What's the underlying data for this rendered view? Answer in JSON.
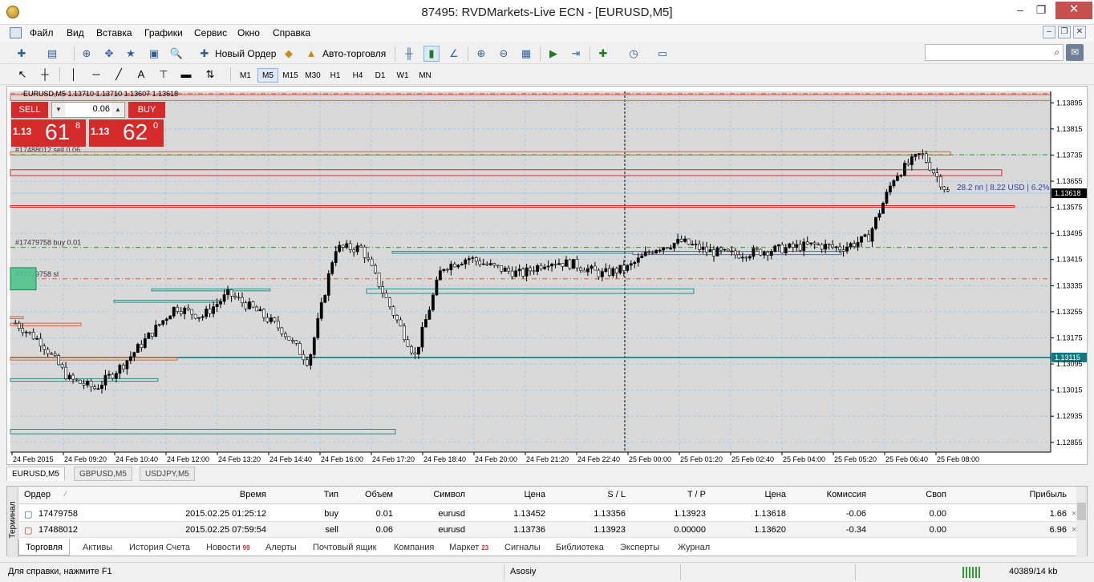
{
  "window": {
    "title": "87495: RVDMarkets-Live ECN - [EURUSD,M5]",
    "minimize": "–",
    "restore": "❐",
    "close": "✕"
  },
  "menu": [
    "Файл",
    "Вид",
    "Вставка",
    "Графики",
    "Сервис",
    "Окно",
    "Справка"
  ],
  "toolbar": {
    "new_order": "Новый Ордер",
    "auto_trading": "Авто-торговля"
  },
  "timeframes": [
    "M1",
    "M5",
    "M15",
    "M30",
    "H1",
    "H4",
    "D1",
    "W1",
    "MN"
  ],
  "active_timeframe": "M5",
  "chart": {
    "ohlc_line": "EURUSD,M5  1.13710 1.13710 1.13607 1.13618",
    "sell_label": "SELL",
    "buy_label": "BUY",
    "lot": "0.06",
    "sell_big": "1.13",
    "sell_pips": "61",
    "sell_frac": "8",
    "buy_big": "1.13",
    "buy_pips": "62",
    "buy_frac": "0",
    "order_labels": [
      "#17488012 sell 0.06",
      "#17479758 buy 0.01",
      "#17479758 sl"
    ],
    "pnl_label": "28.2 пп | 8.22 USD | 6.2%",
    "current_price": "1.13618",
    "line_price": "1.13115",
    "price_ticks": [
      "1.13895",
      "1.13815",
      "1.13735",
      "1.13655",
      "1.13575",
      "1.13495",
      "1.13415",
      "1.13335",
      "1.13255",
      "1.13175",
      "1.13095",
      "1.13015",
      "1.12935",
      "1.12855"
    ],
    "time_ticks": [
      "24 Feb 2015",
      "24 Feb 09:20",
      "24 Feb 10:40",
      "24 Feb 12:00",
      "24 Feb 13:20",
      "24 Feb 14:40",
      "24 Feb 16:00",
      "24 Feb 17:20",
      "24 Feb 18:40",
      "24 Feb 20:00",
      "24 Feb 21:20",
      "24 Feb 22:40",
      "25 Feb 00:00",
      "25 Feb 01:20",
      "25 Feb 02:40",
      "25 Feb 04:00",
      "25 Feb 05:20",
      "25 Feb 06:40",
      "25 Feb 08:00"
    ]
  },
  "chart_data": {
    "type": "candlestick",
    "symbol": "EURUSD",
    "timeframe": "M5",
    "ylim": [
      1.12825,
      1.1393
    ],
    "grid": true,
    "close_trend": [
      1.1322,
      1.1316,
      1.1305,
      1.1302,
      1.1309,
      1.1318,
      1.1327,
      1.1324,
      1.1331,
      1.1326,
      1.132,
      1.131,
      1.1345,
      1.1345,
      1.1328,
      1.1312,
      1.1339,
      1.1342,
      1.1339,
      1.1337,
      1.1341,
      1.134,
      1.1337,
      1.1339,
      1.1345,
      1.1347,
      1.1344,
      1.1343,
      1.1344,
      1.1345,
      1.1346,
      1.1345,
      1.1348,
      1.1367,
      1.1374,
      1.1362
    ],
    "horizontal_lines": [
      {
        "price": 1.13923,
        "kind": "tp",
        "color": "#e05a2a"
      },
      {
        "price": 1.13736,
        "kind": "sell-entry",
        "color": "#2a9a2a"
      },
      {
        "price": 1.13452,
        "kind": "buy-entry",
        "color": "#2a9a2a"
      },
      {
        "price": 1.13356,
        "kind": "sl",
        "color": "#e05a2a"
      },
      {
        "price": 1.13115,
        "kind": "level",
        "color": "#0d7a80"
      }
    ]
  },
  "symbol_tabs": [
    "EURUSD,M5",
    "GBPUSD,M5",
    "USDJPY,M5"
  ],
  "terminal": {
    "side_label": "Терминал",
    "columns": [
      "Ордер",
      "Время",
      "Тип",
      "Объем",
      "Символ",
      "Цена",
      "S / L",
      "T / P",
      "Цена",
      "Комиссия",
      "Своп",
      "Прибыль"
    ],
    "rows": [
      {
        "order": "17479758",
        "time": "2015.02.25 01:25:12",
        "type": "buy",
        "volume": "0.01",
        "symbol": "eurusd",
        "price": "1.13452",
        "sl": "1.13356",
        "tp": "1.13923",
        "cur": "1.13618",
        "commission": "-0.06",
        "swap": "0.00",
        "profit": "1.66"
      },
      {
        "order": "17488012",
        "time": "2015.02.25 07:59:54",
        "type": "sell",
        "volume": "0.06",
        "symbol": "eurusd",
        "price": "1.13736",
        "sl": "1.13923",
        "tp": "0.00000",
        "cur": "1.13620",
        "commission": "-0.34",
        "swap": "0.00",
        "profit": "6.96"
      }
    ]
  },
  "terminal_tabs": [
    "Торговля",
    "Активы",
    "История Счета",
    "Новости",
    "Алерты",
    "Почтовый ящик",
    "Компания",
    "Маркет",
    "Сигналы",
    "Библиотека",
    "Эксперты",
    "Журнал"
  ],
  "badges": {
    "news": "99",
    "market": "23"
  },
  "status": {
    "help": "Для справки, нажмите F1",
    "profile": "Asosiy",
    "traffic": "40389/14 kb"
  }
}
